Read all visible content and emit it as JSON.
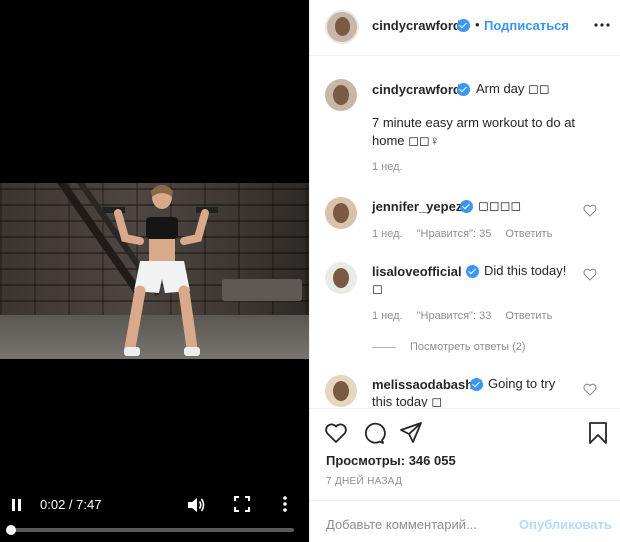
{
  "video": {
    "time_label": "0:02 / 7:47",
    "progress": 0.004,
    "icons": [
      "pause-icon",
      "volume-icon",
      "fullscreen-icon",
      "more-vertical-icon"
    ]
  },
  "header": {
    "username": "cindycrawford",
    "separator": "•",
    "follow_label": "Подписаться"
  },
  "caption": {
    "username": "cindycrawford",
    "line1": "Arm day ◻◻",
    "line2": "7 minute easy arm workout to do at",
    "line3": "home ◻◻♀",
    "time": "1 нед."
  },
  "comments": [
    {
      "username": "jennifer_yepez",
      "text": "◻◻◻◻",
      "time": "1 нед.",
      "likes": "\"Нравится\": 35",
      "reply": "Ответить"
    },
    {
      "username": "lisaloveofficial",
      "text": "Did this today!",
      "text2": "◻",
      "time": "1 нед.",
      "likes": "\"Нравится\": 33",
      "reply": "Ответить",
      "view_replies": "Посмотреть ответы (2)"
    },
    {
      "username": "melissaodabash",
      "text": "Going to try",
      "text2": "this today ◻"
    }
  ],
  "stats": {
    "views": "Просмотры: 346 055",
    "ago": "7 ДНЕЙ НАЗАД"
  },
  "composer": {
    "placeholder": "Добавьте комментарий...",
    "post_label": "Опубликовать"
  },
  "colors": {
    "accent": "#3897f0",
    "muted": "#8e8e8e",
    "progress": "#ff0000",
    "post_disabled": "#b3dbff"
  }
}
